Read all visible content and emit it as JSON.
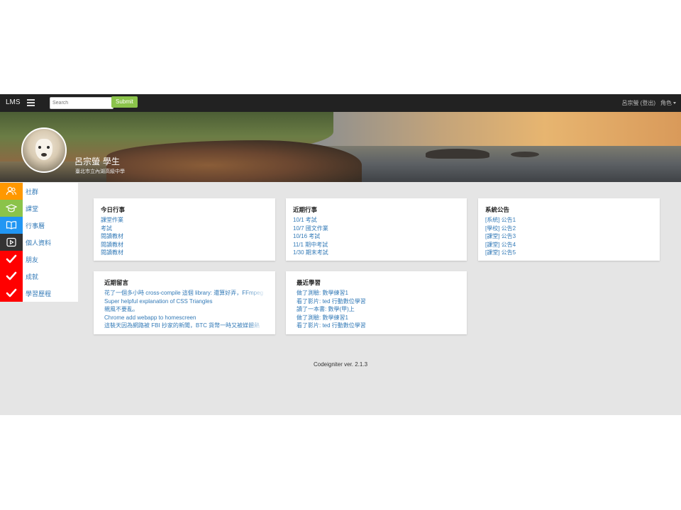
{
  "navbar": {
    "brand": "LMS",
    "search_placeholder": "Search",
    "submit_label": "Submit",
    "user_text": "呂宗螢 (登出)",
    "role_label": "角色"
  },
  "profile": {
    "name": "呂宗螢 學生",
    "school": "臺北市立內湖高級中學"
  },
  "sidebar": {
    "items": [
      {
        "label": "社群",
        "icon": "users-icon",
        "color": "#ff9800"
      },
      {
        "label": "課堂",
        "icon": "graduation-cap-icon",
        "color": "#8bc34a"
      },
      {
        "label": "行事曆",
        "icon": "book-open-icon",
        "color": "#2196f3"
      },
      {
        "label": "個人資料",
        "icon": "play-square-icon",
        "color": "#333333"
      },
      {
        "label": "朋友",
        "icon": "check-icon",
        "color": "#ff0000"
      },
      {
        "label": "成就",
        "icon": "check-icon",
        "color": "#ff0000"
      },
      {
        "label": "學習歷程",
        "icon": "check-icon",
        "color": "#ff0000"
      }
    ]
  },
  "panels": {
    "today": {
      "title": "今日行事",
      "items": [
        "課堂作業",
        "考試",
        "閱讀教材",
        "閱讀教材",
        "閱讀教材"
      ]
    },
    "upcoming": {
      "title": "近期行事",
      "items": [
        "10/1 考試",
        "10/7 國文作業",
        "10/16 考試",
        "11/1 期中考試",
        "1/30 期末考試"
      ]
    },
    "announcements": {
      "title": "系統公告",
      "items": [
        "[系統] 公告1",
        "[學校] 公告2",
        "[課堂] 公告3",
        "[課堂] 公告4",
        "[課堂] 公告5"
      ]
    },
    "messages": {
      "title": "近期留言",
      "items": [
        "花了一個多小時 cross-compile 這個 library: 還算好弄，FFmpeg",
        "Super helpful explanation of CSS Triangles",
        "親風不要亂。",
        "Chrome add webapp to homescreen",
        "這裝天因為網路被 FBI 抄家的新聞，BTC 貨幣一時又被媒體熱"
      ]
    },
    "learning": {
      "title": "最近學習",
      "items": [
        "做了測驗: 數學練習1",
        "看了影片: ted 行動數位學習",
        "讀了一本書: 數學(甲)上",
        "做了測驗: 數學練習1",
        "看了影片: ted 行動數位學習"
      ]
    }
  },
  "footer": {
    "text": "Codeigniter ver. 2.1.3"
  }
}
